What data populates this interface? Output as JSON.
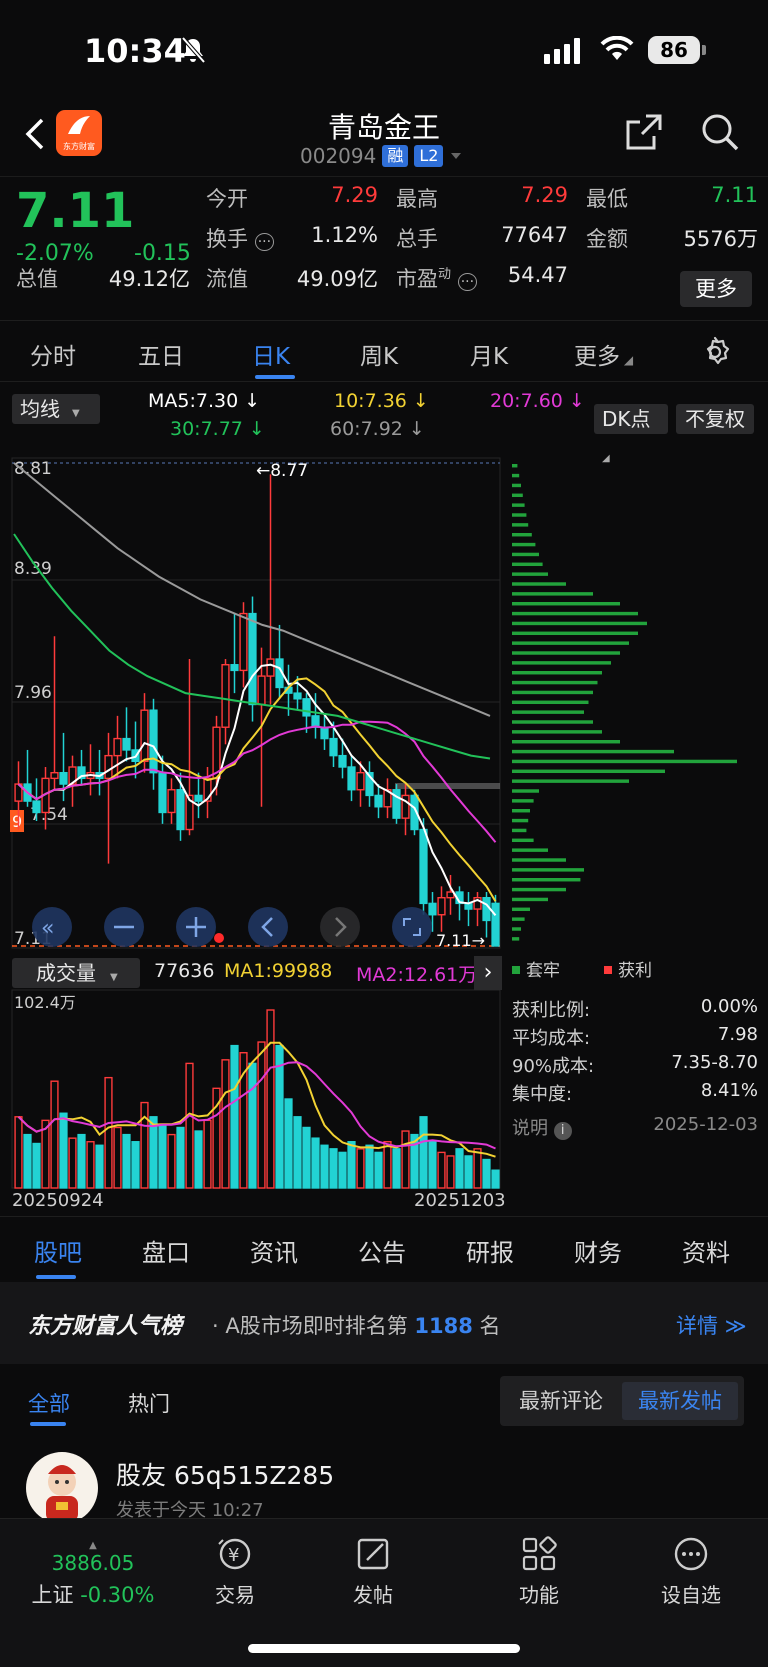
{
  "status": {
    "time": "10:34",
    "battery": "86"
  },
  "header": {
    "name": "青岛金王",
    "code": "002094",
    "badge_margin": "融",
    "badge_level": "L2",
    "logo_text": "东方财富"
  },
  "quote": {
    "price": "7.11",
    "pct": "-2.07%",
    "chg": "-0.15",
    "open_l": "今开",
    "open_v": "7.29",
    "high_l": "最高",
    "high_v": "7.29",
    "low_l": "最低",
    "low_v": "7.11",
    "turn_l": "换手",
    "turn_v": "1.12%",
    "vol_l": "总手",
    "vol_v": "77647",
    "amt_l": "金额",
    "amt_v": "5576万",
    "mcap_l": "总值",
    "mcap_v": "49.12亿",
    "float_l": "流值",
    "float_v": "49.09亿",
    "pe_l": "市盈",
    "pe_sup": "动",
    "pe_v": "54.47",
    "more": "更多"
  },
  "tabs": [
    "分时",
    "五日",
    "日K",
    "周K",
    "月K",
    "更多"
  ],
  "ma": {
    "selector": "均线",
    "ma5": "MA5:7.30 ↓",
    "ma10": "10:7.36 ↓",
    "ma20": "20:7.60 ↓",
    "ma30": "30:7.77 ↓",
    "ma60": "60:7.92 ↓",
    "dk": "DK点",
    "fq": "不复权",
    "colors": {
      "ma5": "#ffffff",
      "ma10": "#f2d233",
      "ma20": "#e23ad6",
      "ma30": "#22c25a",
      "ma60": "#9a9a9a"
    }
  },
  "kline": {
    "y_labels": [
      "8.81",
      "8.39",
      "7.96",
      "7.54",
      "7.11"
    ],
    "high_label": "←8.77",
    "last_label": "7.11→",
    "side_badge": "9"
  },
  "chart_data": {
    "type": "candlestick",
    "start_date": "20250924",
    "end_date": "20251203",
    "ylim": [
      7.11,
      8.81
    ],
    "max_high": 8.77,
    "ohlc": [
      [
        7.62,
        7.76,
        7.52,
        7.68
      ],
      [
        7.68,
        7.8,
        7.6,
        7.62
      ],
      [
        7.62,
        7.7,
        7.55,
        7.58
      ],
      [
        7.58,
        7.74,
        7.52,
        7.7
      ],
      [
        7.7,
        8.2,
        7.66,
        7.72
      ],
      [
        7.72,
        7.86,
        7.62,
        7.68
      ],
      [
        7.68,
        7.78,
        7.6,
        7.74
      ],
      [
        7.74,
        7.8,
        7.68,
        7.7
      ],
      [
        7.7,
        7.82,
        7.64,
        7.72
      ],
      [
        7.72,
        7.8,
        7.64,
        7.7
      ],
      [
        7.7,
        7.86,
        7.4,
        7.78
      ],
      [
        7.78,
        7.92,
        7.7,
        7.84
      ],
      [
        7.84,
        7.95,
        7.76,
        7.8
      ],
      [
        7.8,
        7.9,
        7.7,
        7.76
      ],
      [
        7.76,
        8.0,
        7.72,
        7.94
      ],
      [
        7.94,
        7.98,
        7.66,
        7.72
      ],
      [
        7.72,
        7.78,
        7.54,
        7.58
      ],
      [
        7.58,
        7.7,
        7.54,
        7.66
      ],
      [
        7.66,
        7.72,
        7.48,
        7.52
      ],
      [
        7.52,
        8.12,
        7.5,
        7.64
      ],
      [
        7.64,
        7.72,
        7.56,
        7.62
      ],
      [
        7.62,
        7.74,
        7.56,
        7.7
      ],
      [
        7.7,
        7.92,
        7.64,
        7.88
      ],
      [
        7.88,
        8.12,
        7.82,
        8.1
      ],
      [
        8.1,
        8.28,
        8.0,
        8.08
      ],
      [
        8.08,
        8.32,
        8.02,
        8.28
      ],
      [
        8.28,
        8.34,
        7.9,
        7.96
      ],
      [
        7.96,
        8.16,
        7.6,
        8.06
      ],
      [
        8.06,
        8.77,
        7.96,
        8.12
      ],
      [
        8.12,
        8.24,
        7.98,
        8.02
      ],
      [
        8.02,
        8.1,
        7.92,
        8.0
      ],
      [
        8.0,
        8.06,
        7.94,
        7.98
      ],
      [
        7.98,
        8.0,
        7.86,
        7.92
      ],
      [
        7.92,
        8.0,
        7.84,
        7.88
      ],
      [
        7.88,
        7.92,
        7.8,
        7.84
      ],
      [
        7.84,
        7.9,
        7.74,
        7.78
      ],
      [
        7.78,
        7.84,
        7.7,
        7.74
      ],
      [
        7.74,
        7.78,
        7.62,
        7.66
      ],
      [
        7.66,
        7.76,
        7.6,
        7.72
      ],
      [
        7.72,
        7.76,
        7.6,
        7.64
      ],
      [
        7.64,
        7.68,
        7.56,
        7.6
      ],
      [
        7.6,
        7.7,
        7.56,
        7.66
      ],
      [
        7.66,
        7.68,
        7.54,
        7.56
      ],
      [
        7.56,
        7.68,
        7.5,
        7.64
      ],
      [
        7.64,
        7.66,
        7.5,
        7.52
      ],
      [
        7.52,
        7.56,
        7.22,
        7.26
      ],
      [
        7.26,
        7.3,
        7.16,
        7.22
      ],
      [
        7.22,
        7.32,
        7.16,
        7.28
      ],
      [
        7.28,
        7.36,
        7.22,
        7.3
      ],
      [
        7.3,
        7.32,
        7.2,
        7.26
      ],
      [
        7.26,
        7.3,
        7.18,
        7.24
      ],
      [
        7.24,
        7.3,
        7.18,
        7.28
      ],
      [
        7.28,
        7.3,
        7.14,
        7.2
      ],
      [
        7.26,
        7.29,
        7.11,
        7.11
      ]
    ]
  },
  "chip": {
    "legend_loss": "套牢",
    "legend_gain": "获利",
    "stats": [
      {
        "label": "获利比例:",
        "value": "0.00%"
      },
      {
        "label": "平均成本:",
        "value": "7.98"
      },
      {
        "label": "90%成本:",
        "value": "7.35-8.70"
      },
      {
        "label": "集中度:",
        "value": "8.41%"
      }
    ],
    "note": "说明",
    "date": "2025-12-03"
  },
  "volume": {
    "selector": "成交量",
    "value": "77636",
    "ma1": "MA1:99988",
    "ma2": "MA2:12.61万",
    "max_label": "102.4万",
    "date_start": "20250924",
    "date_end": "20251203"
  },
  "sub_tabs": [
    "股吧",
    "盘口",
    "资讯",
    "公告",
    "研报",
    "财务",
    "资料"
  ],
  "popular": {
    "brand": "东方财富人气榜",
    "text": "· A股市场即时排名第",
    "rank": "1188",
    "suffix": "名",
    "detail": "详情 ≫"
  },
  "feed": {
    "all": "全部",
    "hot": "热门",
    "latest_comment": "最新评论",
    "latest_post": "最新发帖"
  },
  "post": {
    "user": "股友 65q515Z285",
    "time": "发表于今天 10:27"
  },
  "bottom": {
    "index_value": "3886.05",
    "index_label": "上证",
    "index_pct": "-0.30%",
    "items": [
      "交易",
      "发帖",
      "功能",
      "设自选"
    ]
  }
}
